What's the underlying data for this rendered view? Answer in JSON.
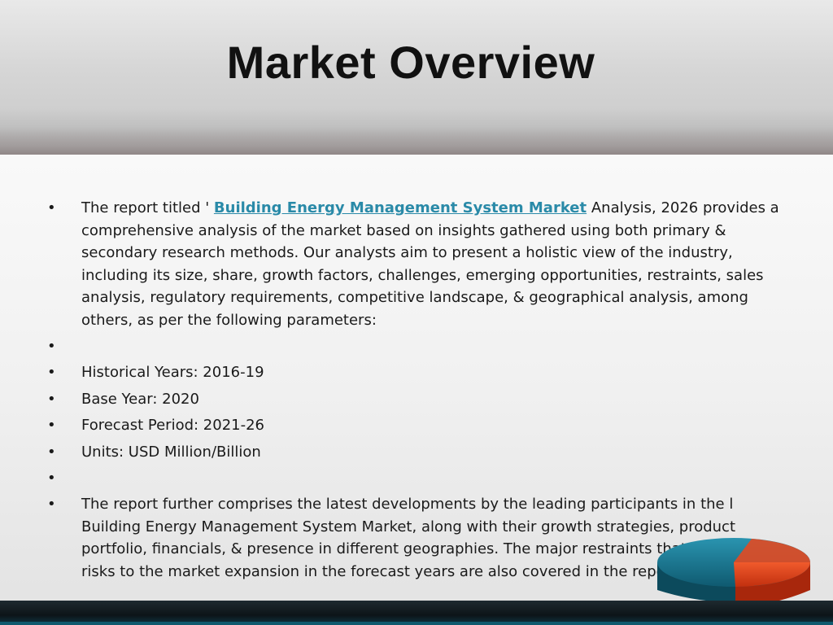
{
  "slide": {
    "title": "Market Overview",
    "intro": {
      "prefix": "The report titled ' ",
      "link_text": "Building Energy Management System Market",
      "suffix": " Analysis, 2026 provides a comprehensive analysis of the market based on insights gathered using both primary & secondary research methods. Our analysts aim to present a holistic view of the industry, including its size, share, growth factors, challenges, emerging opportunities, restraints, sales analysis, regulatory requirements, competitive landscape, & geographical analysis, among others, as per the following parameters:"
    },
    "parameters": [
      "Historical Years: 2016-19",
      "Base Year: 2020",
      "Forecast Period: 2021-26",
      "Units: USD Million/Billion"
    ],
    "closing": "The report further comprises the latest developments by the leading participants in the l Building Energy Management System Market, along with their growth strategies, product portfolio, financials, & presence in different geographies. The major restraints that may pose risks to the market expansion in the forecast years are also covered in the report.",
    "bullet_char": "•"
  },
  "colors": {
    "link": "#2a8aa8",
    "pie_blue": "#16718c",
    "pie_red": "#e2401c",
    "footer": "#0e3845"
  }
}
